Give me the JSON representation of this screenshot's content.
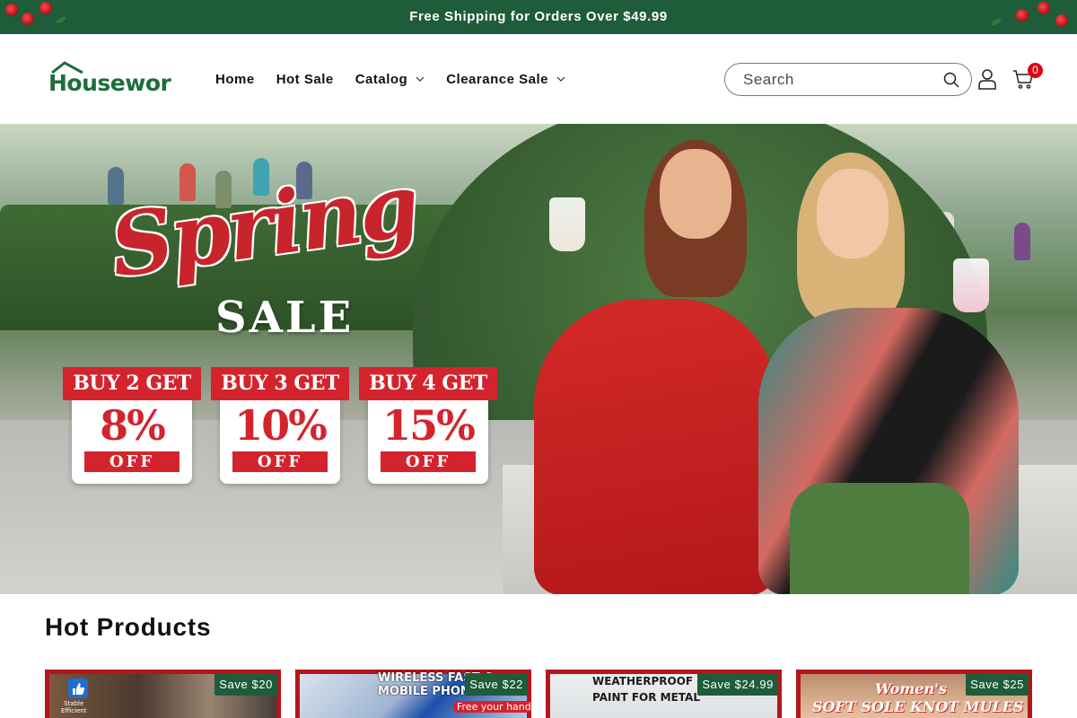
{
  "announcement": {
    "text": "Free Shipping for Orders Over $49.99"
  },
  "header": {
    "logo_text": "Housewor",
    "nav": [
      {
        "label": "Home"
      },
      {
        "label": "Hot Sale"
      },
      {
        "label": "Catalog"
      },
      {
        "label": "Clearance Sale"
      }
    ],
    "search_placeholder": "Search",
    "cart_count": "0",
    "colors": {
      "brand_green": "#1e5c3a",
      "logo_green": "#1e6e3a",
      "logo_red": "#c4161c",
      "cart_badge": "#e00016"
    }
  },
  "hero": {
    "headline": "Spring",
    "subheadline": "SALE",
    "offers": [
      {
        "buy": "BUY 2 GET",
        "percent": "8%",
        "off": "OFF"
      },
      {
        "buy": "BUY 3 GET",
        "percent": "10%",
        "off": "OFF"
      },
      {
        "buy": "BUY 4 GET",
        "percent": "15%",
        "off": "OFF"
      }
    ],
    "colors": {
      "promo_red": "#d3242e"
    }
  },
  "hot_products": {
    "title": "Hot Products",
    "items": [
      {
        "badge": "Save $20",
        "caption": "",
        "small_text": "Stable\nEfficient"
      },
      {
        "badge": "Save $22",
        "caption": "WIRELESS FAST C\nMOBILE PHONE HO",
        "small_text": "Free your hands"
      },
      {
        "badge": "Save $24.99",
        "caption": "WEATHERPROOF RUS\nPAINT FOR METAL",
        "small_text": ""
      },
      {
        "badge": "Save $25",
        "caption": "Women's\nSOFT SOLE KNOT MULES",
        "small_text": ""
      }
    ]
  }
}
